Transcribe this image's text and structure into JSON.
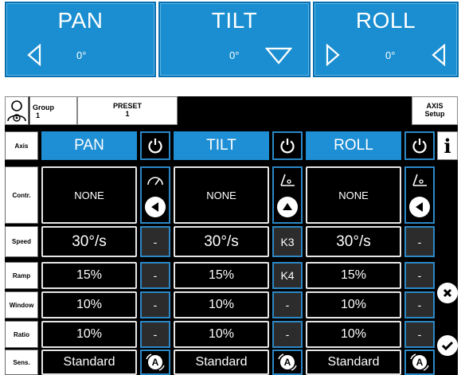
{
  "axis_tiles": [
    {
      "title": "PAN",
      "degree": "0°",
      "arrow": "left-triangle-outline"
    },
    {
      "title": "TILT",
      "degree": "0°",
      "arrow": "down-triangle-outline"
    },
    {
      "title": "ROLL",
      "degree": "0°",
      "arrow": "right-left-triangles"
    }
  ],
  "header": {
    "group_label": "Group",
    "group_value": "1",
    "preset_label": "PRESET",
    "preset_value": "1",
    "axis_setup_line1": "AXIS",
    "axis_setup_line2": "Setup"
  },
  "row_labels": {
    "axis": "Axis",
    "contr": "Contr.",
    "speed": "Speed",
    "ramp": "Ramp",
    "window": "Window",
    "ratio": "Ratio",
    "sens": "Sens."
  },
  "columns": [
    {
      "axis": "PAN",
      "control": "NONE",
      "speed": "30°/s",
      "ramp": "15%",
      "window": "10%",
      "ratio": "10%",
      "sens": "Standard",
      "speed_key": "-",
      "ramp_key": "-",
      "window_key": "-",
      "ratio_key": "-",
      "mode_icon": "speedometer-icon",
      "dir_icon": "left-arrow-circle-icon"
    },
    {
      "axis": "TILT",
      "control": "NONE",
      "speed": "30°/s",
      "ramp": "15%",
      "window": "10%",
      "ratio": "10%",
      "sens": "Standard",
      "speed_key": "K3",
      "ramp_key": "K4",
      "window_key": "-",
      "ratio_key": "-",
      "mode_icon": "angle-icon",
      "dir_icon": "up-arrow-circle-icon"
    },
    {
      "axis": "ROLL",
      "control": "NONE",
      "speed": "30°/s",
      "ramp": "15%",
      "window": "10%",
      "ratio": "10%",
      "sens": "Standard",
      "speed_key": "-",
      "ramp_key": "-",
      "window_key": "-",
      "ratio_key": "-",
      "mode_icon": "angle-icon",
      "dir_icon": "left-arrow-circle-icon"
    }
  ],
  "side_buttons": {
    "info": "i"
  },
  "colors": {
    "tile_blue": "#1a8ed0",
    "header_blue": "#1e8fd4",
    "accent_blue": "#2d88c6",
    "panel_black": "#000000"
  }
}
